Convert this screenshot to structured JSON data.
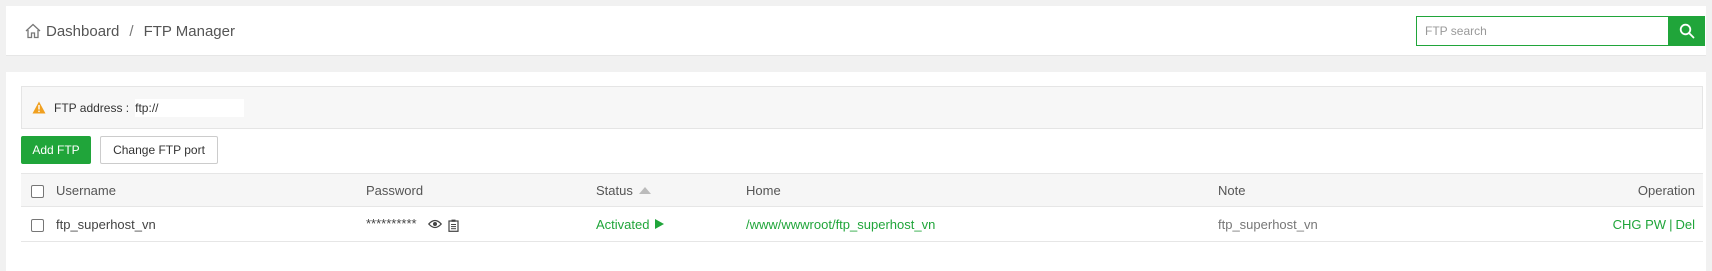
{
  "breadcrumb": {
    "home": "Dashboard",
    "separator": "/",
    "current": "FTP Manager"
  },
  "search": {
    "placeholder": "FTP search"
  },
  "notice": {
    "label": "FTP address :",
    "value": "ftp://"
  },
  "toolbar": {
    "add_label": "Add FTP",
    "port_label": "Change FTP port"
  },
  "table": {
    "columns": [
      "Username",
      "Password",
      "Status",
      "Home",
      "Note",
      "Operation"
    ],
    "rows": [
      {
        "username": "ftp_superhost_vn",
        "password": "**********",
        "status": "Activated",
        "home": "/www/wwwroot/ftp_superhost_vn",
        "note": "ftp_superhost_vn",
        "op_change": "CHG PW",
        "op_sep": "|",
        "op_delete": "Del"
      }
    ]
  },
  "colors": {
    "accent": "#20a53a",
    "warning": "#f0a020"
  }
}
